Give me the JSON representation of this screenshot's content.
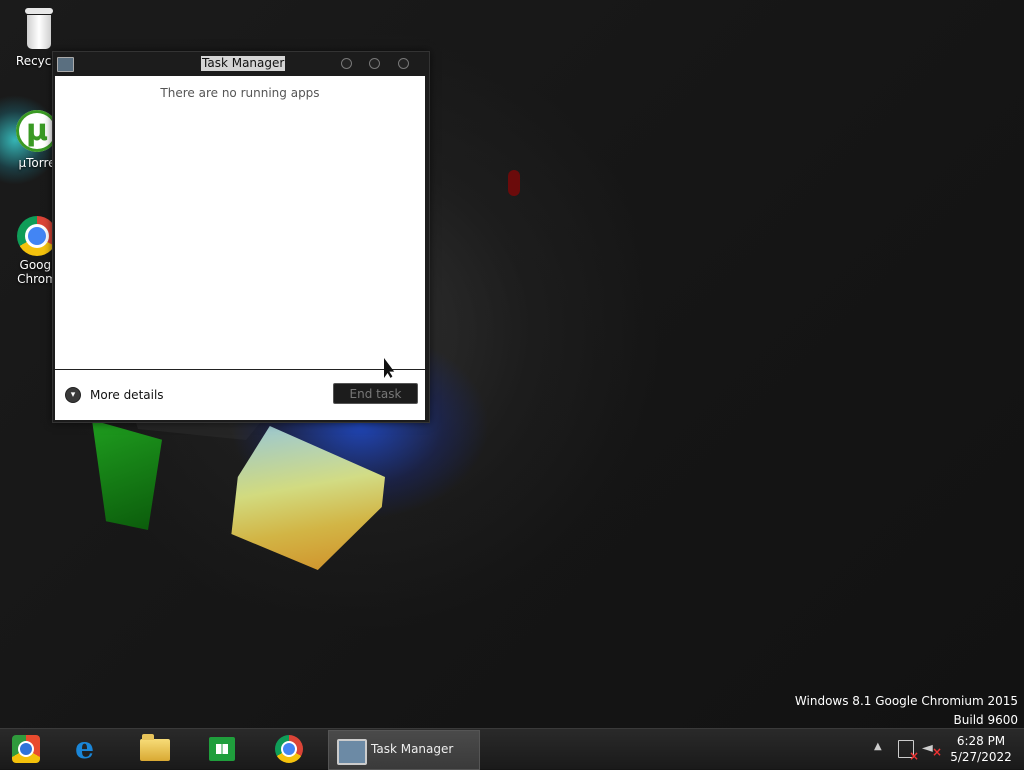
{
  "desktop": {
    "icons": [
      {
        "label": "Recycle"
      },
      {
        "label": "µTorre"
      },
      {
        "label": "Googl\nChrom"
      }
    ],
    "watermark": {
      "line1": "Windows 8.1 Google Chromium 2015",
      "line2": "Build 9600"
    }
  },
  "window": {
    "title": "Task Manager",
    "empty_message": "There are no running apps",
    "more_details_label": "More details",
    "end_task_label": "End task"
  },
  "taskbar": {
    "pinned": [
      "browser-icon",
      "internet-explorer-icon",
      "file-explorer-icon",
      "store-icon",
      "chrome-icon"
    ],
    "active_task_label": "Task Manager",
    "clock_time": "6:28 PM",
    "clock_date": "5/27/2022"
  },
  "colors": {
    "accent_green": "#1f9e3c",
    "tray_error_red": "#ee3333"
  }
}
